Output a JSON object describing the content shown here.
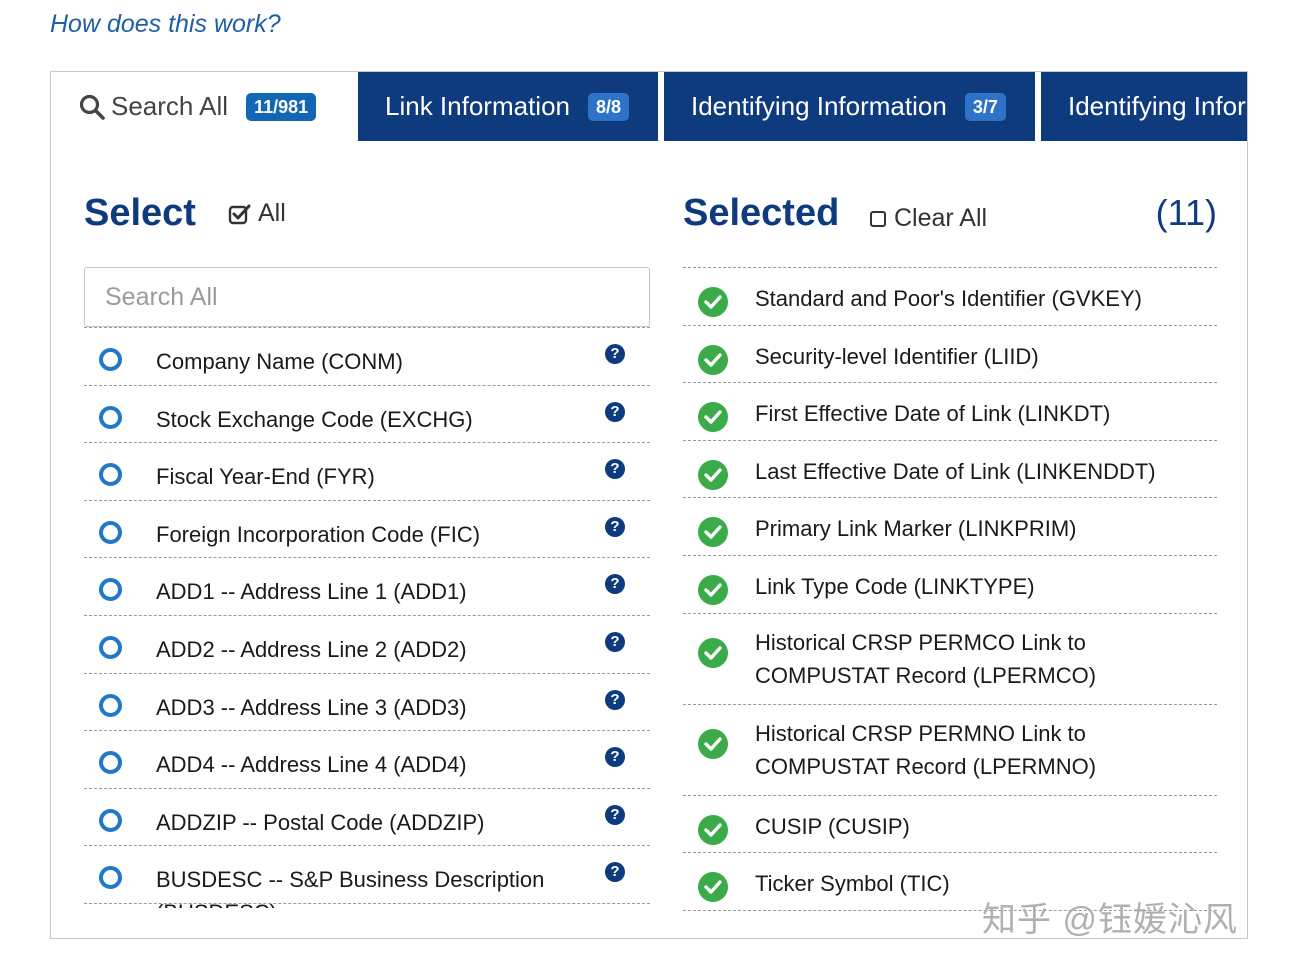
{
  "help_link": "How does this work?",
  "tabs": [
    {
      "label": "Search All",
      "badge": "11/981"
    },
    {
      "label": "Link Information",
      "badge": "8/8"
    },
    {
      "label": "Identifying Information",
      "badge": "3/7"
    },
    {
      "label": "Identifying Infor"
    }
  ],
  "select_panel": {
    "title": "Select",
    "all_label": "All",
    "search_placeholder": "Search All",
    "items": [
      "Company Name (CONM)",
      "Stock Exchange Code (EXCHG)",
      "Fiscal Year-End (FYR)",
      "Foreign Incorporation Code (FIC)",
      "ADD1 -- Address Line 1 (ADD1)",
      "ADD2 -- Address Line 2 (ADD2)",
      "ADD3 -- Address Line 3 (ADD3)",
      "ADD4 -- Address Line 4 (ADD4)",
      "ADDZIP -- Postal Code (ADDZIP)",
      "BUSDESC -- S&P Business Description (BUSDESC)"
    ],
    "help_glyph": "?"
  },
  "selected_panel": {
    "title": "Selected",
    "clear_label": "Clear All",
    "count": "(11)",
    "items": [
      "Standard and Poor's Identifier (GVKEY)",
      "Security-level Identifier (LIID)",
      "First Effective Date of Link (LINKDT)",
      "Last Effective Date of Link (LINKENDDT)",
      "Primary Link Marker (LINKPRIM)",
      "Link Type Code (LINKTYPE)",
      "Historical CRSP PERMCO Link to COMPUSTAT Record (LPERMCO)",
      "Historical CRSP PERMNO Link to COMPUSTAT Record (LPERMNO)",
      "CUSIP (CUSIP)",
      "Ticker Symbol (TIC)"
    ]
  },
  "watermark": "知乎 @钰媛沁风",
  "colors": {
    "navy": "#0e3a7e",
    "badge_blue": "#1266b6",
    "radio_blue": "#1f78c8",
    "check_green": "#3aab48",
    "link_blue": "#1f5fa8"
  }
}
